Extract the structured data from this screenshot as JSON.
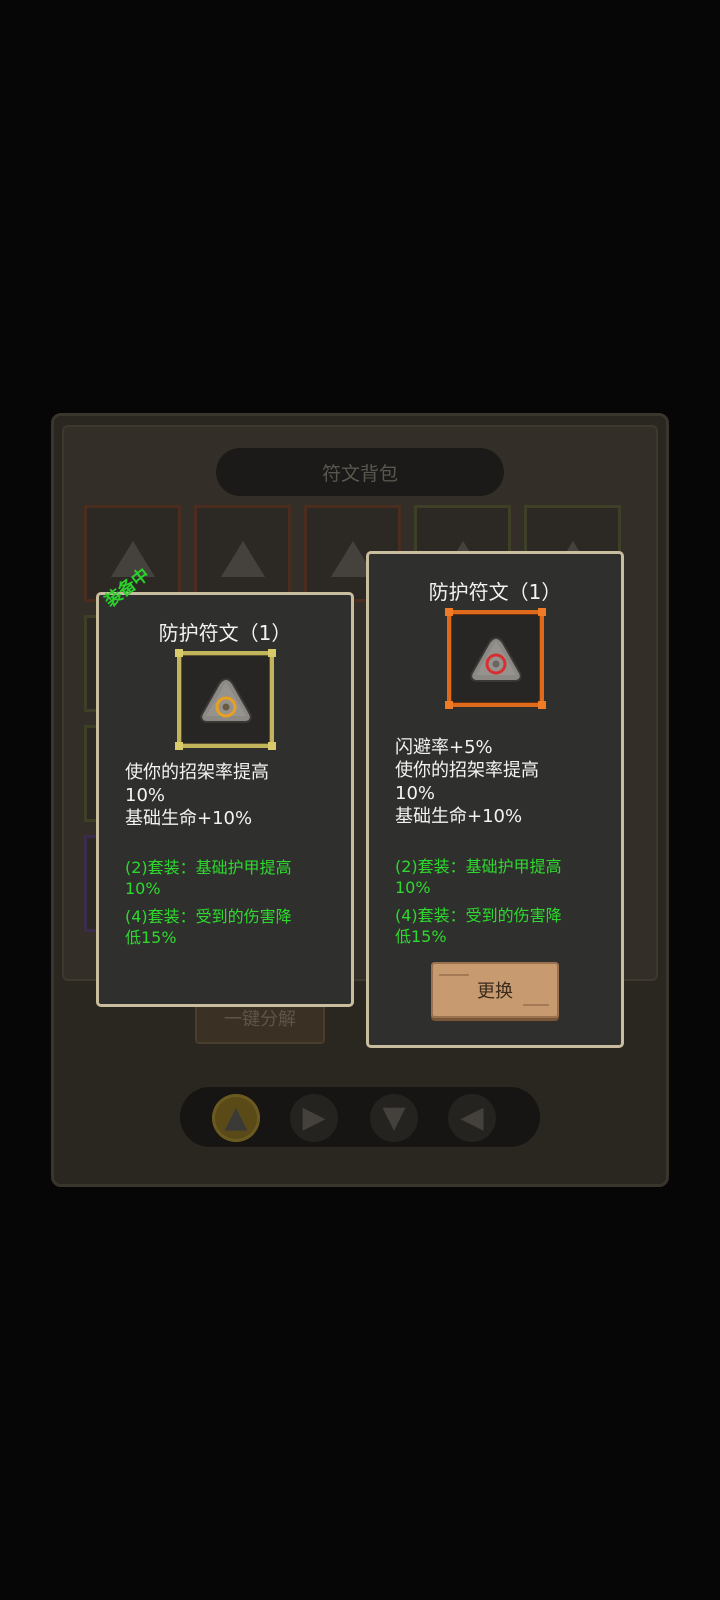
{
  "bag": {
    "title": "符文背包",
    "decompose_label": "一键分解",
    "filters": [
      {
        "shape": "triangle",
        "icon": "triangle-rune-icon",
        "active": true
      },
      {
        "shape": "play",
        "icon": "arrow-right-rune-icon",
        "active": false
      },
      {
        "shape": "diamond",
        "icon": "diamond-rune-icon",
        "active": false
      },
      {
        "shape": "play-left",
        "icon": "arrow-left-rune-icon",
        "active": false
      }
    ]
  },
  "equipped_card": {
    "badge": "装备中",
    "title": "防护符文（1）",
    "icon": "protection-rune-gold-icon",
    "rune_color": "#e8a020",
    "lines": [
      "使你的招架率提高",
      "10%",
      "基础生命+10%"
    ],
    "set_bonus": [
      [
        "(2)套装：基础护甲提高",
        "10%"
      ],
      [
        "(4)套装：受到的伤害降",
        "低15%"
      ]
    ]
  },
  "compare_card": {
    "title": "防护符文（1）",
    "icon": "protection-rune-orange-icon",
    "rune_color": "#d83030",
    "lines": [
      "闪避率+5%",
      "使你的招架率提高",
      "10%",
      "基础生命+10%"
    ],
    "set_bonus": [
      [
        "(2)套装：基础护甲提高",
        "10%"
      ],
      [
        "(4)套装：受到的伤害降",
        "低15%"
      ]
    ],
    "swap_label": "更换"
  },
  "colors": {
    "set_text": "#2fd82f",
    "card_border": "#c9bd9f",
    "gold_frame": "#c2b45a",
    "orange_frame": "#e06a1c"
  }
}
